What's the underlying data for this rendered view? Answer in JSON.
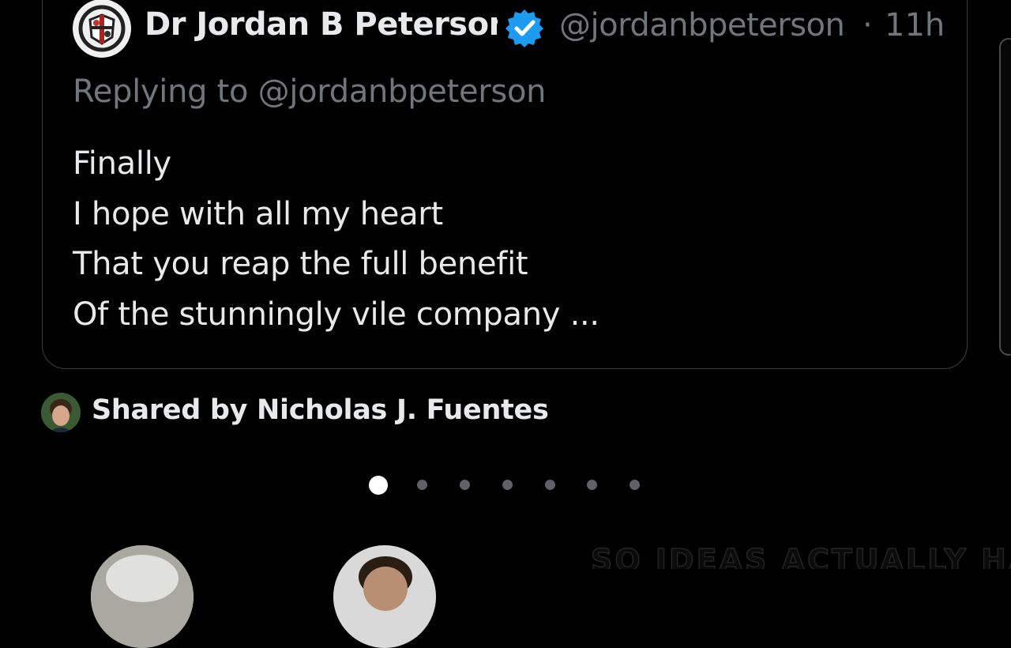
{
  "tweet": {
    "author_name": "Dr Jordan B Peterson",
    "handle": "@jordanbpeterson",
    "separator": "·",
    "timestamp": "11h",
    "replying_to": "Replying to @jordanbpeterson",
    "lines": [
      "Finally",
      "I hope with all my heart",
      "That you reap the full benefit",
      "Of the stunningly vile company ..."
    ]
  },
  "shared_by": {
    "label": "Shared by Nicholas J. Fuentes"
  },
  "pager": {
    "count": 7,
    "active_index": 0
  },
  "bottom_caption": "SO IDEAS ACTUALLY HAVE",
  "colors": {
    "verified": "#1d9bf0",
    "secondary_text": "#71767b",
    "border": "#3a3d41"
  },
  "icons": [
    "verified-badge-icon"
  ]
}
